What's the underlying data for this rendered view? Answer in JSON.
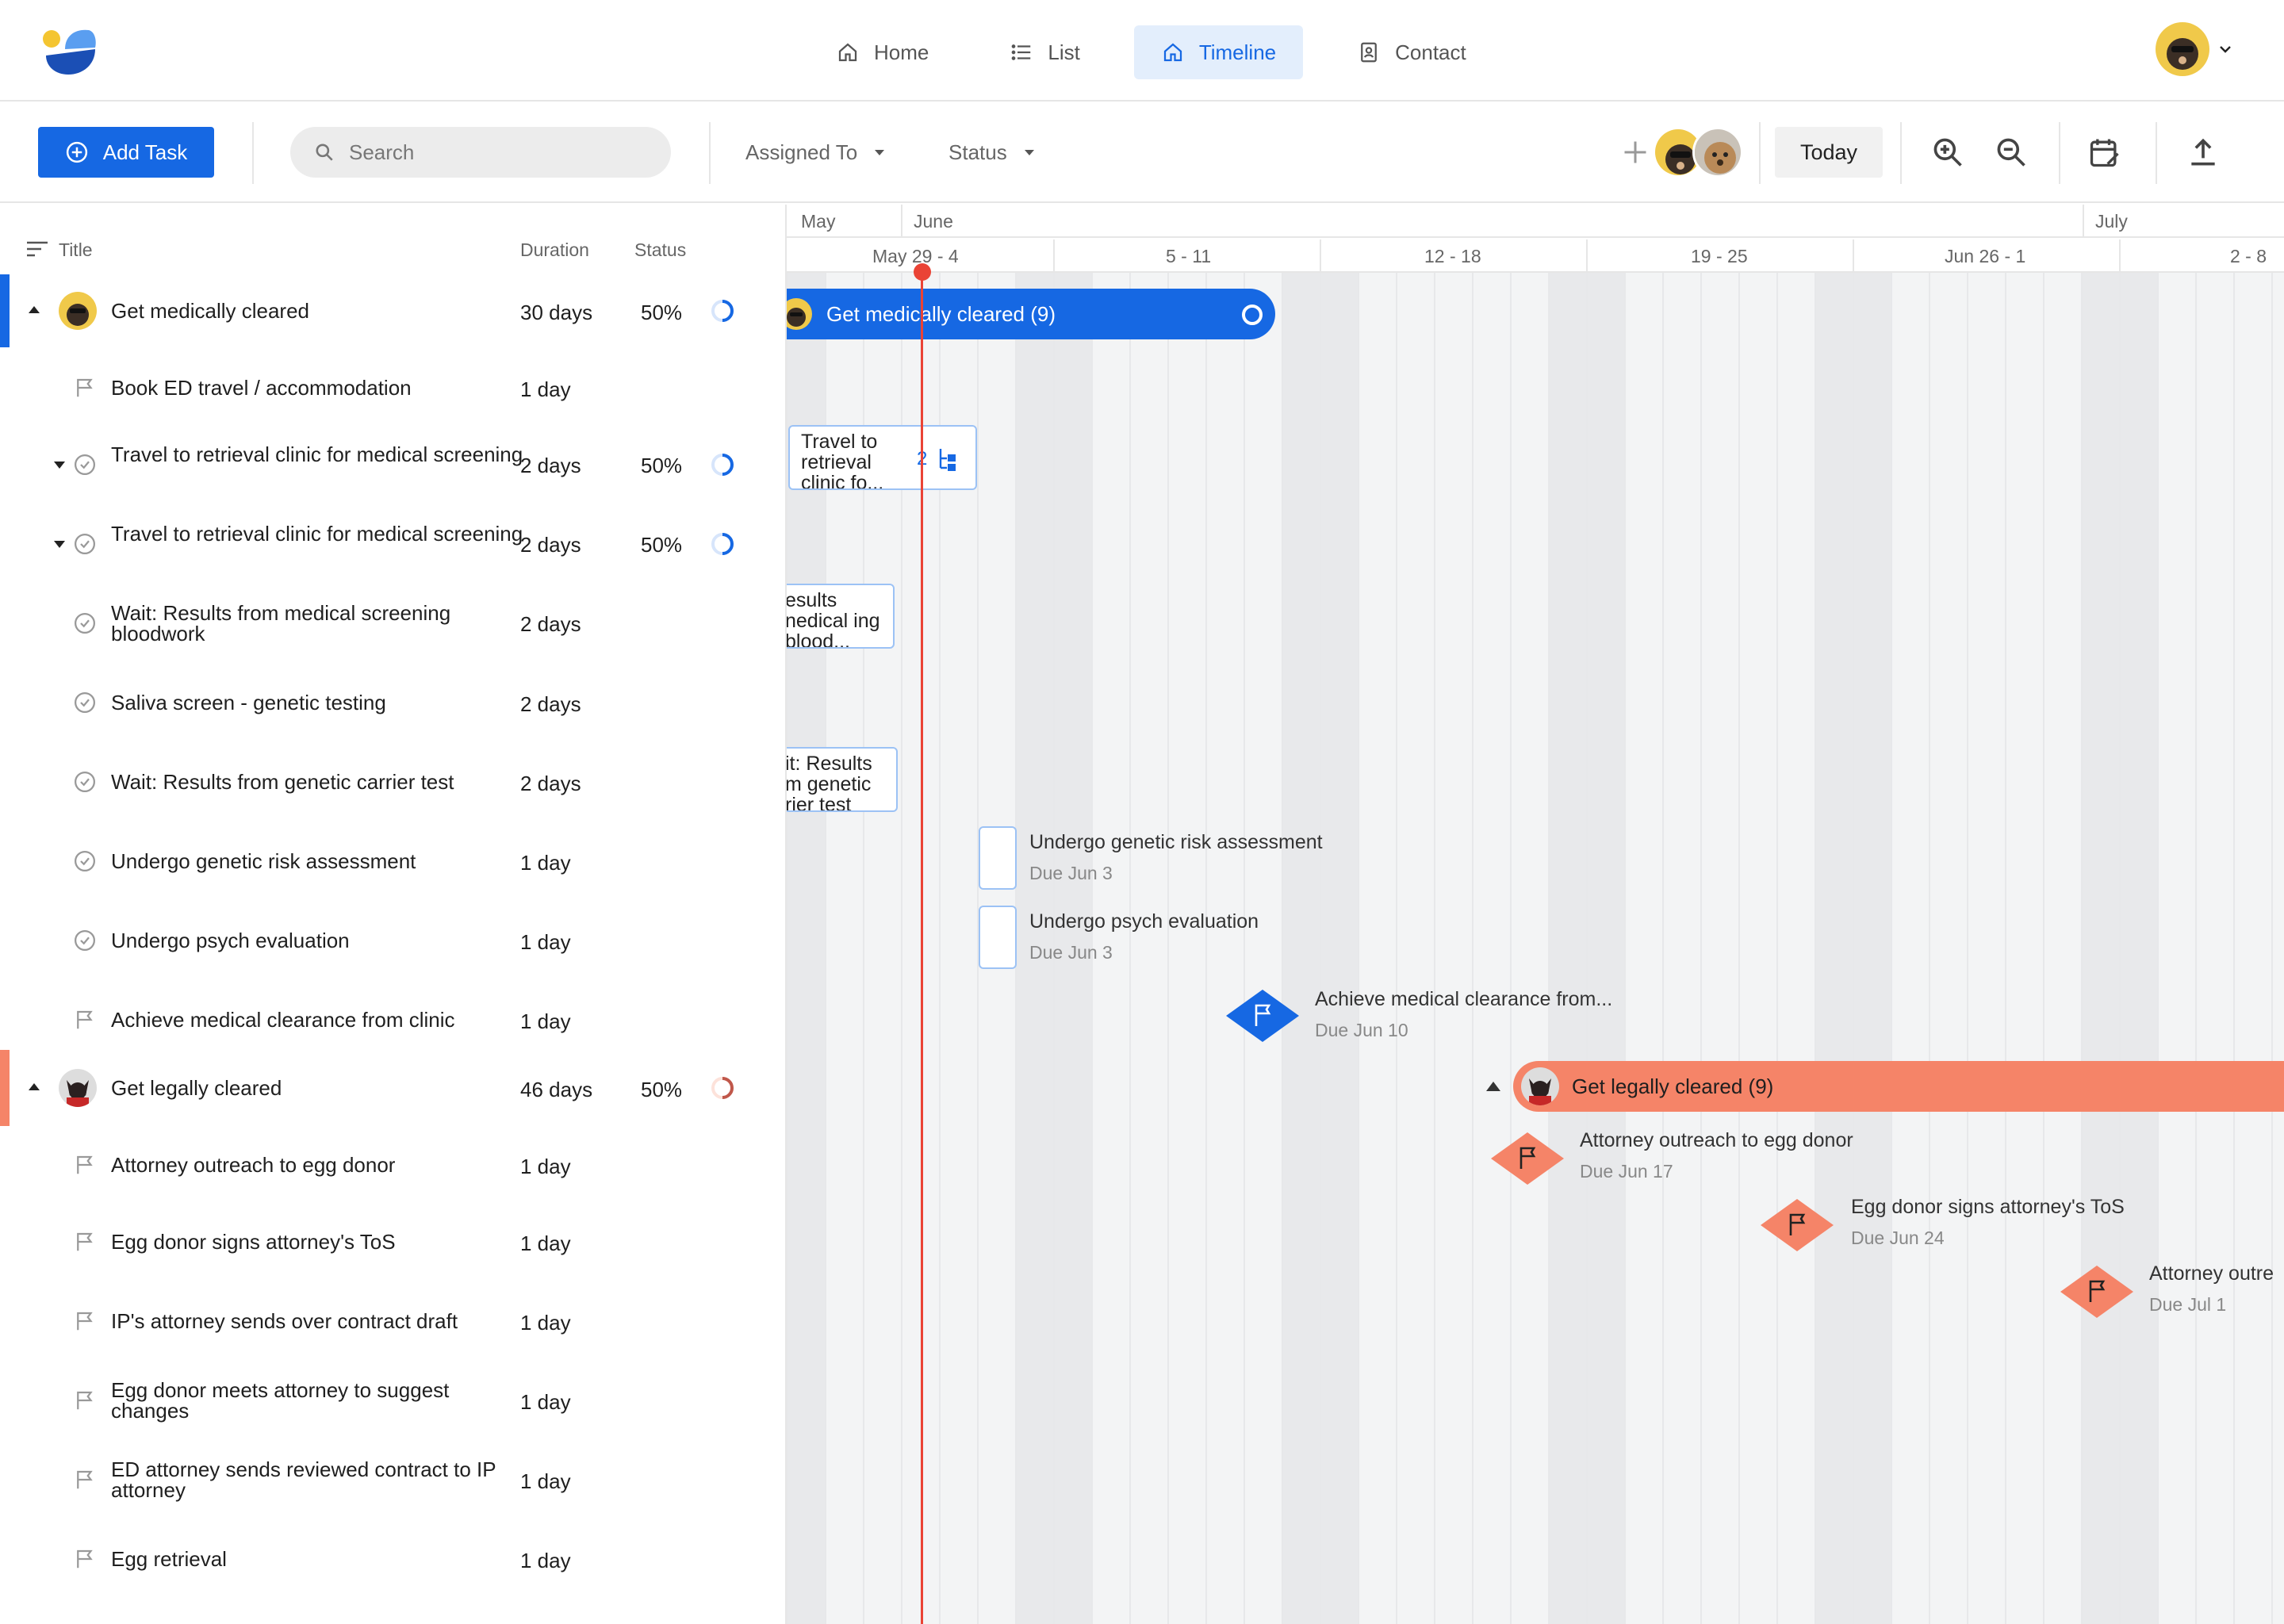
{
  "nav": {
    "items": [
      {
        "label": "Home",
        "icon": "home-icon"
      },
      {
        "label": "List",
        "icon": "list-icon"
      },
      {
        "label": "Timeline",
        "icon": "timeline-icon"
      },
      {
        "label": "Contact",
        "icon": "contact-icon"
      }
    ],
    "active": "Timeline"
  },
  "toolbar": {
    "add_task_label": "Add Task",
    "search_placeholder": "Search",
    "assigned_to_label": "Assigned To",
    "status_label": "Status",
    "today_label": "Today"
  },
  "columns": {
    "title": "Title",
    "duration": "Duration",
    "status": "Status"
  },
  "tasks": [
    {
      "title": "Get medically cleared",
      "duration": "30 days",
      "status": "50%",
      "type": "group",
      "color": "#1668e3"
    },
    {
      "title": "Book ED travel / accommodation",
      "duration": "1 day",
      "type": "milestone"
    },
    {
      "title": "Travel to retrieval clinic for medical screening",
      "duration": "2 days",
      "status": "50%",
      "type": "subgroup"
    },
    {
      "title": "Travel to retrieval clinic for medical screening",
      "duration": "2 days",
      "status": "50%",
      "type": "subgroup"
    },
    {
      "title": "Wait: Results from medical screening bloodwork",
      "duration": "2 days",
      "type": "task"
    },
    {
      "title": "Saliva screen - genetic testing",
      "duration": "2 days",
      "type": "task"
    },
    {
      "title": "Wait: Results from genetic carrier test",
      "duration": "2 days",
      "type": "task"
    },
    {
      "title": "Undergo genetic risk assessment",
      "duration": "1 day",
      "type": "task"
    },
    {
      "title": "Undergo psych evaluation",
      "duration": "1 day",
      "type": "task"
    },
    {
      "title": "Achieve medical clearance from clinic",
      "duration": "1 day",
      "type": "milestone"
    },
    {
      "title": "Get legally cleared",
      "duration": "46 days",
      "status": "50%",
      "type": "group",
      "color": "#f58468"
    },
    {
      "title": "Attorney outreach to egg donor",
      "duration": "1 day",
      "type": "milestone"
    },
    {
      "title": "Egg donor signs attorney's ToS",
      "duration": "1 day",
      "type": "milestone"
    },
    {
      "title": "IP's attorney sends over contract draft",
      "duration": "1 day",
      "type": "milestone"
    },
    {
      "title": "Egg donor meets attorney to suggest changes",
      "duration": "1 day",
      "type": "milestone"
    },
    {
      "title": "ED attorney sends reviewed contract to IP attorney",
      "duration": "1 day",
      "type": "milestone"
    },
    {
      "title": "Egg retrieval",
      "duration": "1 day",
      "type": "milestone"
    }
  ],
  "timeline": {
    "months": [
      "May",
      "June",
      "July"
    ],
    "weeks": [
      "May 29 - 4",
      "5 - 11",
      "12  - 18",
      "19 - 25",
      "Jun 26 - 1",
      "2 - 8"
    ],
    "bars": {
      "medical_group": "Get medically cleared (9)",
      "legal_group": "Get legally cleared (9)",
      "travel_box": "Travel to retrieval clinic fo...",
      "travel_box_count": "2",
      "results_box": "esults nedical ing blood...",
      "genetic_box": "it: Results m genetic rier test"
    },
    "items": {
      "genetic_risk": {
        "label": "Undergo genetic risk assessment",
        "due": "Due Jun 3"
      },
      "psych": {
        "label": "Undergo psych evaluation",
        "due": "Due Jun 3"
      },
      "clearance": {
        "label": "Achieve medical clearance from...",
        "due": "Due Jun 10"
      },
      "outreach": {
        "label": "Attorney outreach to egg donor",
        "due": "Due Jun 17"
      },
      "tos": {
        "label": "Egg donor signs attorney's ToS",
        "due": "Due Jun 24"
      },
      "attorney_cut": {
        "label": "Attorney outre",
        "due": "Due Jul 1"
      }
    }
  },
  "colors": {
    "primary": "#1668e3",
    "legal": "#f58468",
    "today": "#ea4335"
  }
}
